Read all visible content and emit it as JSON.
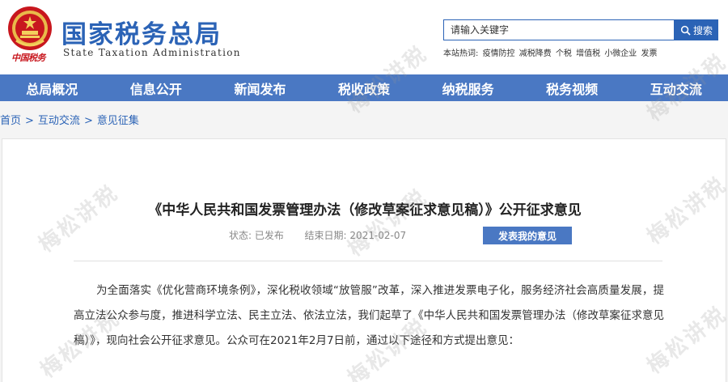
{
  "header": {
    "site_title": "国家税务总局",
    "site_title_en": "State Taxation Administration",
    "china_tax_mark": "中国税务"
  },
  "search": {
    "placeholder": "请输入关键字",
    "button_label": "搜索"
  },
  "hot": {
    "label": "本站热词:",
    "terms": [
      "疫情防控",
      "减税降费",
      "个税",
      "增值税",
      "小微企业",
      "发票"
    ]
  },
  "nav": {
    "items": [
      "总局概况",
      "信息公开",
      "新闻发布",
      "税收政策",
      "纳税服务",
      "税务视频",
      "互动交流"
    ]
  },
  "breadcrumb": [
    "首页",
    "互动交流",
    "意见征集"
  ],
  "article": {
    "title": "《中华人民共和国发票管理办法（修改草案征求意见稿）》公开征求意见",
    "status_label": "状态:",
    "status_value": "已发布",
    "end_date_label": "结束日期:",
    "end_date_value": "2021-02-07",
    "comment_button": "发表我的意见",
    "body": "为全面落实《优化营商环境条例》，深化税收领域“放管服”改革，深入推进发票电子化，服务经济社会高质量发展，提高立法公众参与度，推进科学立法、民主立法、依法立法，我们起草了《中华人民共和国发票管理办法（修改草案征求意见稿）》，现向社会公开征求意见。公众可在2021年2月7日前，通过以下途径和方式提出意见："
  },
  "watermark": "梅松讲税",
  "colors": {
    "brand_blue": "#2b63b6",
    "nav_blue": "#4a78c3",
    "emblem_red": "#c8171e"
  }
}
